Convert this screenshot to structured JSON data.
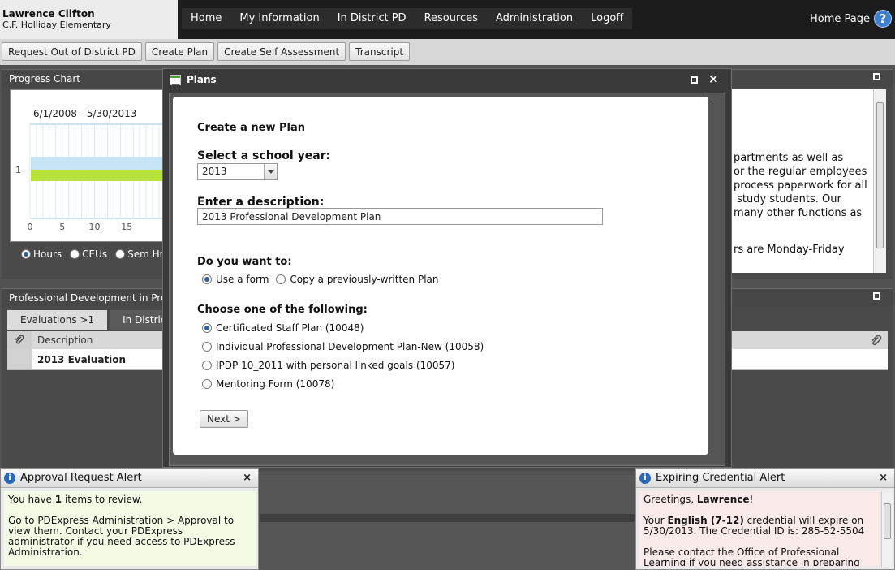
{
  "user": {
    "name": "Lawrence Clifton",
    "school": "C.F. Holliday Elementary"
  },
  "nav": [
    "Home",
    "My Information",
    "In District PD",
    "Resources",
    "Administration",
    "Logoff"
  ],
  "home_page_label": "Home Page",
  "help_label": "?",
  "toolbar": [
    "Request Out of District PD",
    "Create Plan",
    "Create Self Assessment",
    "Transcript"
  ],
  "progress_chart": {
    "title": "Progress Chart",
    "date_range": "6/1/2008 - 5/30/2013",
    "radios": [
      {
        "label": "Hours",
        "selected": true
      },
      {
        "label": "CEUs",
        "selected": false
      },
      {
        "label": "Sem Hrs",
        "selected": false
      }
    ]
  },
  "chart_data": {
    "type": "bar",
    "orientation": "horizontal",
    "categories": [
      "1"
    ],
    "x_ticks": [
      0,
      5,
      10,
      15
    ],
    "colors": {
      "bar_top": "#c6e5f6",
      "bar_bottom": "#b7e33a"
    }
  },
  "info_text": "partments as well as\nor the regular employees\nprocess paperwork for all\n study students. Our\nmany other functions as",
  "info_text2": "rs are Monday-Friday",
  "pd_panel": {
    "title": "Professional Development in Progre",
    "tabs": [
      "Evaluations >1",
      "In District I"
    ],
    "column_description": "Description",
    "row_description": "2013 Evaluation"
  },
  "modal": {
    "title": "Plans",
    "close_glyph": "×",
    "heading": "Create a new Plan",
    "year_label": "Select a school year:",
    "year_value": "2013",
    "description_label": "Enter a description:",
    "description_value": "2013 Professional Development Plan",
    "want_label": "Do you want to:",
    "want_options": [
      {
        "label": "Use a form",
        "selected": true
      },
      {
        "label": "Copy a previously-written Plan",
        "selected": false
      }
    ],
    "choose_label": "Choose one of the following:",
    "plan_options": [
      {
        "label": "Certificated Staff Plan (10048)",
        "selected": true
      },
      {
        "label": "Individual Professional Development Plan-New (10058)",
        "selected": false
      },
      {
        "label": "IPDP 10_2011 with personal linked goals (10057)",
        "selected": false
      },
      {
        "label": "Mentoring Form (10078)",
        "selected": false
      }
    ],
    "next_label": "Next >"
  },
  "approval_alert": {
    "title": "Approval Request Alert",
    "close_glyph": "×",
    "line1_prefix": "You have ",
    "count": "1",
    "line1_suffix": " items to review.",
    "line2": "Go to PDExpress Administration > Approval to view them. Contact your PDExpress administrator if you need access to PDExpress Administration."
  },
  "credential_alert": {
    "title": "Expiring Credential Alert",
    "close_glyph": "×",
    "greeting_prefix": "Greetings, ",
    "greeting_name": "Lawrence",
    "greeting_suffix": "!",
    "cred_prefix": "Your ",
    "credential": "English (7-12)",
    "cred_suffix": " credential will expire on 5/30/2013. The Credential ID is: 285-52-5504",
    "contact": "Please contact the Office of Professional Learning if you need assistance in preparing for renewal."
  }
}
